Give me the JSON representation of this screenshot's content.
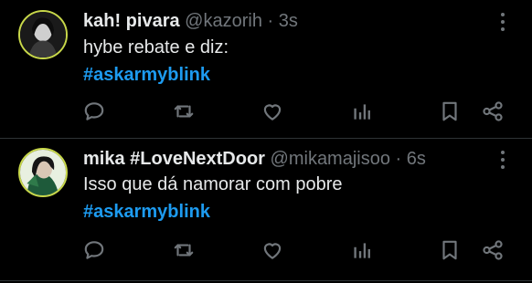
{
  "tweets": [
    {
      "name": "kah! pivara",
      "handle": "@kazorih",
      "separator": " · ",
      "time": "3s",
      "text": "hybe rebate e diz:",
      "hashtag": "#askarmyblink"
    },
    {
      "name": "mika #LoveNextDoor",
      "handle": "@mikamajisoo",
      "separator": " · ",
      "time": "6s",
      "text": "Isso que dá namorar com pobre",
      "hashtag": "#askarmyblink"
    }
  ],
  "actions": [
    "reply-icon",
    "retweet-icon",
    "like-icon",
    "views-icon",
    "bookmark-icon",
    "share-icon"
  ],
  "colors": {
    "background": "#000000",
    "text": "#e7e9ea",
    "muted": "#71767b",
    "accent": "#1d9bf0",
    "divider": "#2f3336"
  }
}
